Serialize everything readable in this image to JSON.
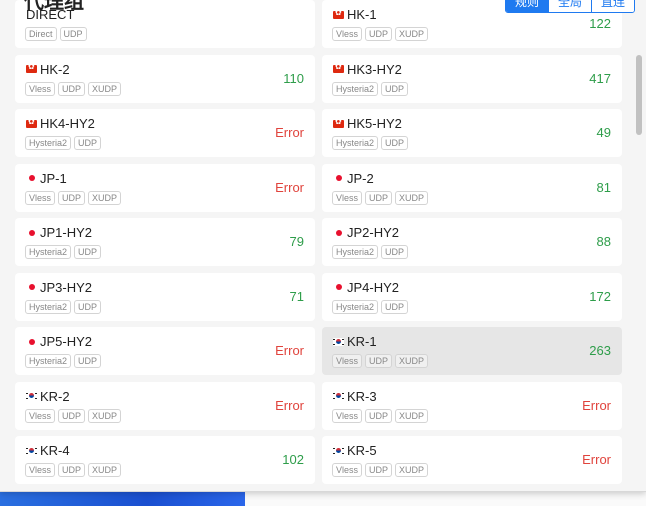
{
  "header": {
    "title": "代理组",
    "modes": [
      "规则",
      "全局",
      "直连"
    ]
  },
  "proxies": [
    {
      "name": "DIRECT",
      "flag": "",
      "tags": [
        "Direct",
        "UDP"
      ],
      "delay": ""
    },
    {
      "name": "HK-1",
      "flag": "hk",
      "tags": [
        "Vless",
        "UDP",
        "XUDP"
      ],
      "delay": "122"
    },
    {
      "name": "HK-2",
      "flag": "hk",
      "tags": [
        "Vless",
        "UDP",
        "XUDP"
      ],
      "delay": "110"
    },
    {
      "name": "HK3-HY2",
      "flag": "hk",
      "tags": [
        "Hysteria2",
        "UDP"
      ],
      "delay": "417"
    },
    {
      "name": "HK4-HY2",
      "flag": "hk",
      "tags": [
        "Hysteria2",
        "UDP"
      ],
      "delay": "Error"
    },
    {
      "name": "HK5-HY2",
      "flag": "hk",
      "tags": [
        "Hysteria2",
        "UDP"
      ],
      "delay": "49"
    },
    {
      "name": "JP-1",
      "flag": "jp",
      "tags": [
        "Vless",
        "UDP",
        "XUDP"
      ],
      "delay": "Error"
    },
    {
      "name": "JP-2",
      "flag": "jp",
      "tags": [
        "Vless",
        "UDP",
        "XUDP"
      ],
      "delay": "81"
    },
    {
      "name": "JP1-HY2",
      "flag": "jp",
      "tags": [
        "Hysteria2",
        "UDP"
      ],
      "delay": "79"
    },
    {
      "name": "JP2-HY2",
      "flag": "jp",
      "tags": [
        "Hysteria2",
        "UDP"
      ],
      "delay": "88"
    },
    {
      "name": "JP3-HY2",
      "flag": "jp",
      "tags": [
        "Hysteria2",
        "UDP"
      ],
      "delay": "71"
    },
    {
      "name": "JP4-HY2",
      "flag": "jp",
      "tags": [
        "Hysteria2",
        "UDP"
      ],
      "delay": "172"
    },
    {
      "name": "JP5-HY2",
      "flag": "jp",
      "tags": [
        "Hysteria2",
        "UDP"
      ],
      "delay": "Error"
    },
    {
      "name": "KR-1",
      "flag": "kr",
      "tags": [
        "Vless",
        "UDP",
        "XUDP"
      ],
      "delay": "263",
      "selected": true
    },
    {
      "name": "KR-2",
      "flag": "kr",
      "tags": [
        "Vless",
        "UDP",
        "XUDP"
      ],
      "delay": "Error"
    },
    {
      "name": "KR-3",
      "flag": "kr",
      "tags": [
        "Vless",
        "UDP",
        "XUDP"
      ],
      "delay": "Error"
    },
    {
      "name": "KR-4",
      "flag": "kr",
      "tags": [
        "Vless",
        "UDP",
        "XUDP"
      ],
      "delay": "102"
    },
    {
      "name": "KR-5",
      "flag": "kr",
      "tags": [
        "Vless",
        "UDP",
        "XUDP"
      ],
      "delay": "Error"
    }
  ],
  "colors": {
    "accent": "#1f7af0",
    "delay_ok": "#2e9d4a",
    "delay_error": "#e0433c"
  }
}
